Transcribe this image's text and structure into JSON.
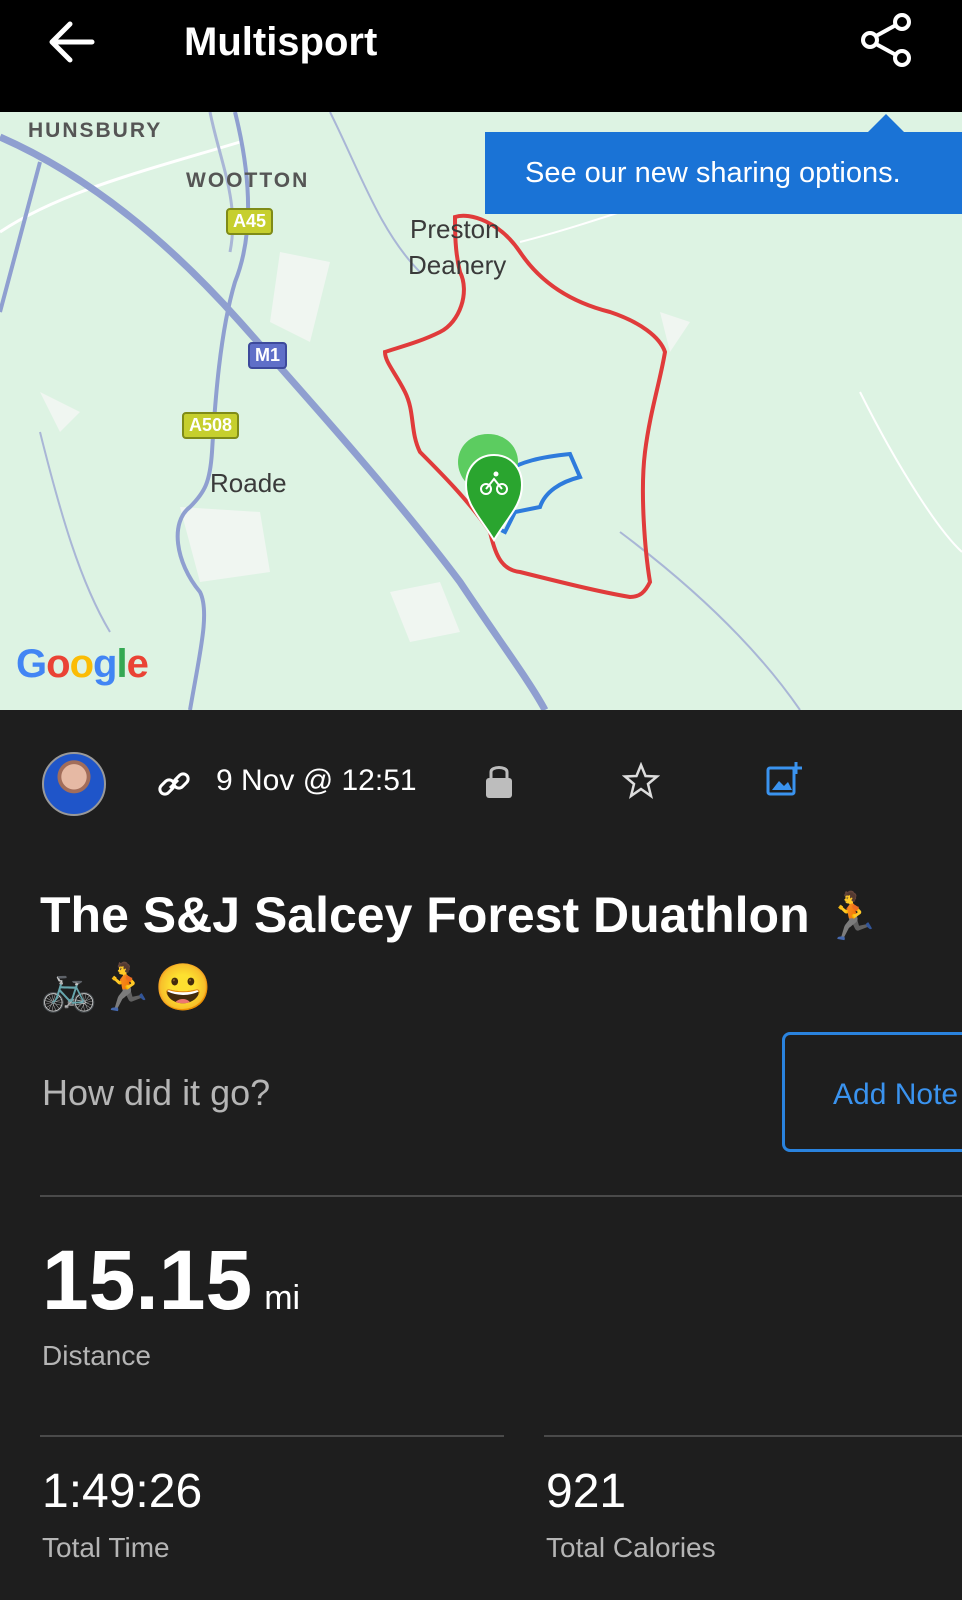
{
  "topbar": {
    "title": "Multisport",
    "back_icon": "arrow-left-icon",
    "share_icon": "share-icon"
  },
  "map": {
    "labels": {
      "hunsbury": "HUNSBURY",
      "wootton": "WOOTTON",
      "preston": "Preston",
      "deanery": "Deanery",
      "roade": "Roade"
    },
    "shields": {
      "a45": "A45",
      "m1": "M1",
      "a508": "A508"
    },
    "google": "Google",
    "route_colors": {
      "run": "#e03b3b",
      "bike": "#2e7bdc",
      "marker": "#2aa52f"
    }
  },
  "tooltip": {
    "text": "See our new sharing options."
  },
  "activity": {
    "date": "9 Nov @ 12:51",
    "title": "The S&J Salcey Forest Duathlon",
    "title_emoji_1": "🏃",
    "title_emoji_2": "🚲🏃😀"
  },
  "note": {
    "prompt": "How did it go?",
    "button": "Add Note"
  },
  "stats": {
    "distance": {
      "value": "15.15",
      "unit": "mi",
      "label": "Distance"
    },
    "time": {
      "value": "1:49:26",
      "label": "Total Time"
    },
    "calories": {
      "value": "921",
      "label": "Total Calories"
    }
  },
  "colors": {
    "background": "#1e1e1e",
    "accent": "#2a83de"
  }
}
